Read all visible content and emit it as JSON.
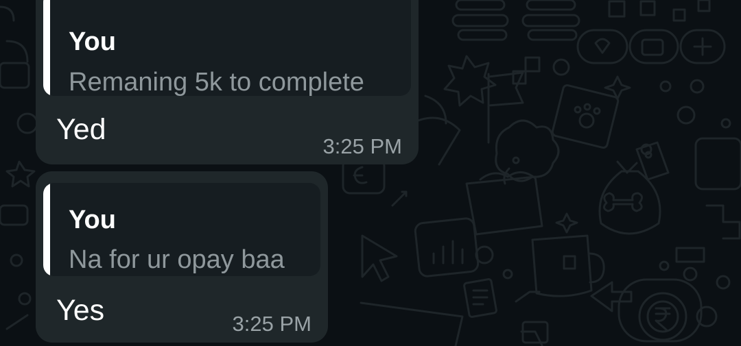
{
  "theme": {
    "background": "#0b1014",
    "bubble_color": "#1f272a",
    "quote_bg": "#161d21",
    "quote_bar": "#ffffff",
    "timestamp_color": "#9aa3a7"
  },
  "messages": [
    {
      "reply_to": {
        "author": "You",
        "text": "Remaning 5k to complete"
      },
      "text": "Yed",
      "time": "3:25 PM"
    },
    {
      "reply_to": {
        "author": "You",
        "text": "Na for ur opay baa"
      },
      "text": "Yes",
      "time": "3:25 PM"
    }
  ]
}
